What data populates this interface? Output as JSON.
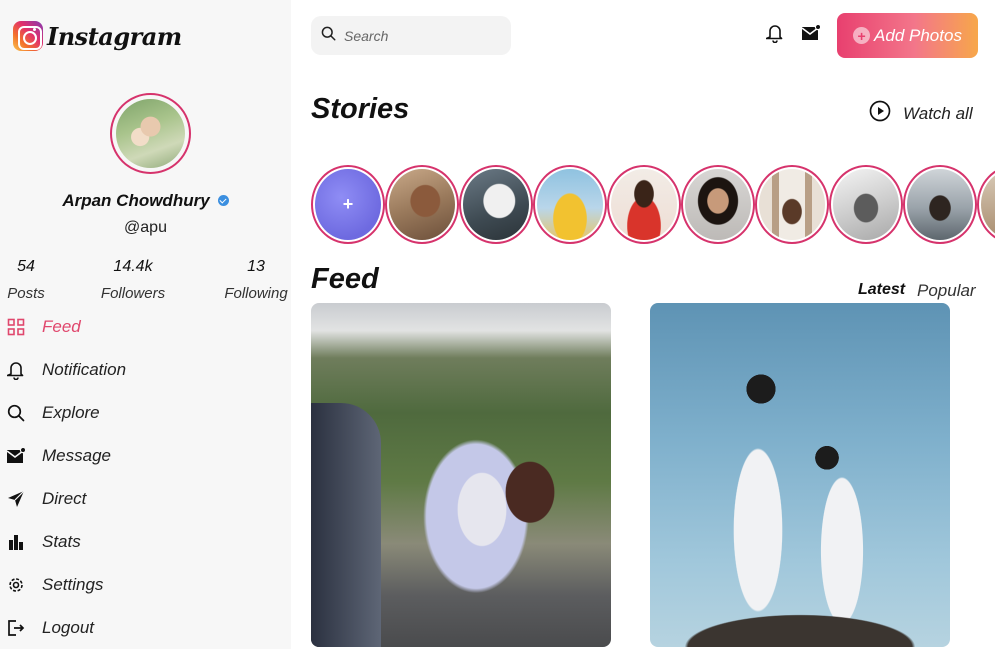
{
  "app": {
    "logo_text": "Instagram"
  },
  "profile": {
    "name": "Arpan Chowdhury",
    "handle": "@apu",
    "verified": true,
    "stats": [
      {
        "value": "54",
        "label": "Posts"
      },
      {
        "value": "14.4k",
        "label": "Followers"
      },
      {
        "value": "13",
        "label": "Following"
      }
    ]
  },
  "nav": {
    "items": [
      {
        "label": "Feed",
        "icon": "grid-icon",
        "active": true
      },
      {
        "label": "Notification",
        "icon": "bell-icon",
        "active": false
      },
      {
        "label": "Explore",
        "icon": "search-icon",
        "active": false
      },
      {
        "label": "Message",
        "icon": "mail-icon",
        "active": false
      },
      {
        "label": "Direct",
        "icon": "send-icon",
        "active": false
      },
      {
        "label": "Stats",
        "icon": "bar-chart-icon",
        "active": false
      },
      {
        "label": "Settings",
        "icon": "gear-icon",
        "active": false
      },
      {
        "label": "Logout",
        "icon": "logout-icon",
        "active": false
      }
    ]
  },
  "header": {
    "search_placeholder": "Search",
    "add_photos_label": "Add Photos"
  },
  "stories": {
    "title": "Stories",
    "watch_all_label": "Watch all",
    "add_story_symbol": "+"
  },
  "feed": {
    "title": "Feed",
    "tabs": [
      {
        "label": "Latest",
        "active": true
      },
      {
        "label": "Popular",
        "active": false
      }
    ]
  },
  "colors": {
    "accent": "#e0476d",
    "story_ring": "#d6336c",
    "verified": "#3b8fe0",
    "sidebar_bg": "#f7f7f7",
    "button_gradient_start": "#e8406f",
    "button_gradient_end": "#f7a74a"
  }
}
